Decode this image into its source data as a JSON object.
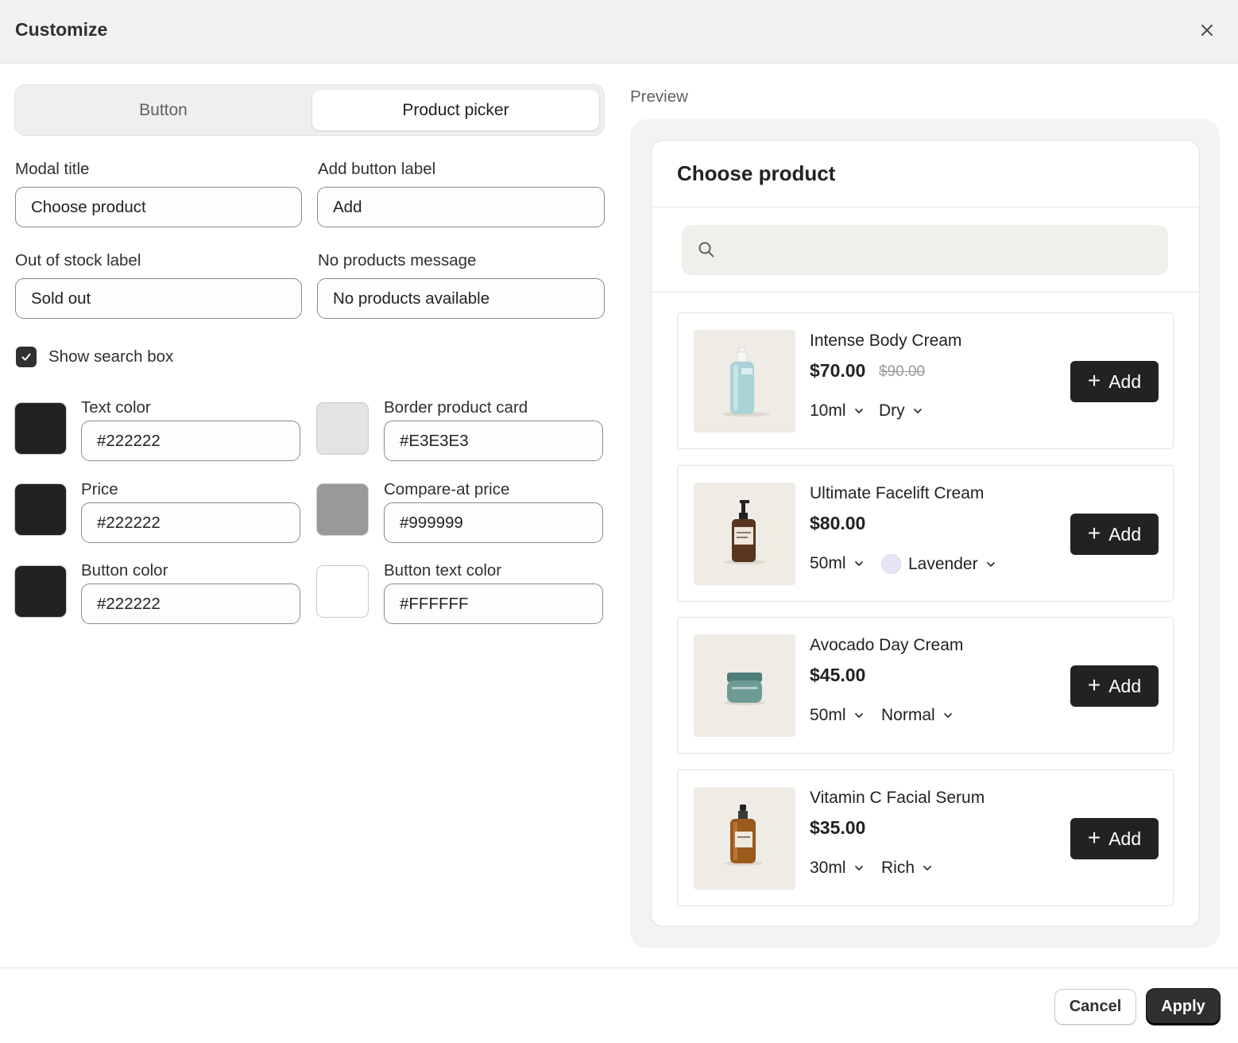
{
  "header": {
    "title": "Customize",
    "close_icon": "close-icon"
  },
  "tabs": [
    {
      "label": "Button",
      "selected": false
    },
    {
      "label": "Product picker",
      "selected": true
    }
  ],
  "fields": {
    "modal_title": {
      "label": "Modal title",
      "value": "Choose product"
    },
    "add_button_label": {
      "label": "Add button label",
      "value": "Add"
    },
    "out_of_stock_label": {
      "label": "Out of stock label",
      "value": "Sold out"
    },
    "no_products_message": {
      "label": "No products message",
      "value": "No products available"
    }
  },
  "show_search": {
    "label": "Show search box",
    "checked": true
  },
  "colors": {
    "text_color": {
      "label": "Text color",
      "value": "#222222"
    },
    "border_product_card": {
      "label": "Border product card",
      "value": "#E3E3E3"
    },
    "price": {
      "label": "Price",
      "value": "#222222"
    },
    "compare_at_price": {
      "label": "Compare-at price",
      "value": "#999999"
    },
    "button_color": {
      "label": "Button color",
      "value": "#222222"
    },
    "button_text_color": {
      "label": "Button text color",
      "value": "#FFFFFF"
    }
  },
  "preview": {
    "label": "Preview",
    "modal_title": "Choose product",
    "search_icon": "search-icon",
    "products": [
      {
        "name": "Intense Body Cream",
        "price": "$70.00",
        "compare_price": "$90.00",
        "option1": "10ml",
        "option2": "Dry",
        "add_label": "Add",
        "image": "pump-bottle-teal"
      },
      {
        "name": "Ultimate Facelift Cream",
        "price": "$80.00",
        "compare_price": "",
        "option1": "50ml",
        "option2": "Lavender",
        "option2_swatch": "#E6E4F7",
        "add_label": "Add",
        "image": "pump-bottle-amber"
      },
      {
        "name": "Avocado Day Cream",
        "price": "$45.00",
        "compare_price": "",
        "option1": "50ml",
        "option2": "Normal",
        "add_label": "Add",
        "image": "jar-green"
      },
      {
        "name": "Vitamin C Facial Serum",
        "price": "$35.00",
        "compare_price": "",
        "option1": "30ml",
        "option2": "Rich",
        "add_label": "Add",
        "image": "dropper-bottle-amber"
      }
    ]
  },
  "footer": {
    "cancel": "Cancel",
    "apply": "Apply"
  }
}
